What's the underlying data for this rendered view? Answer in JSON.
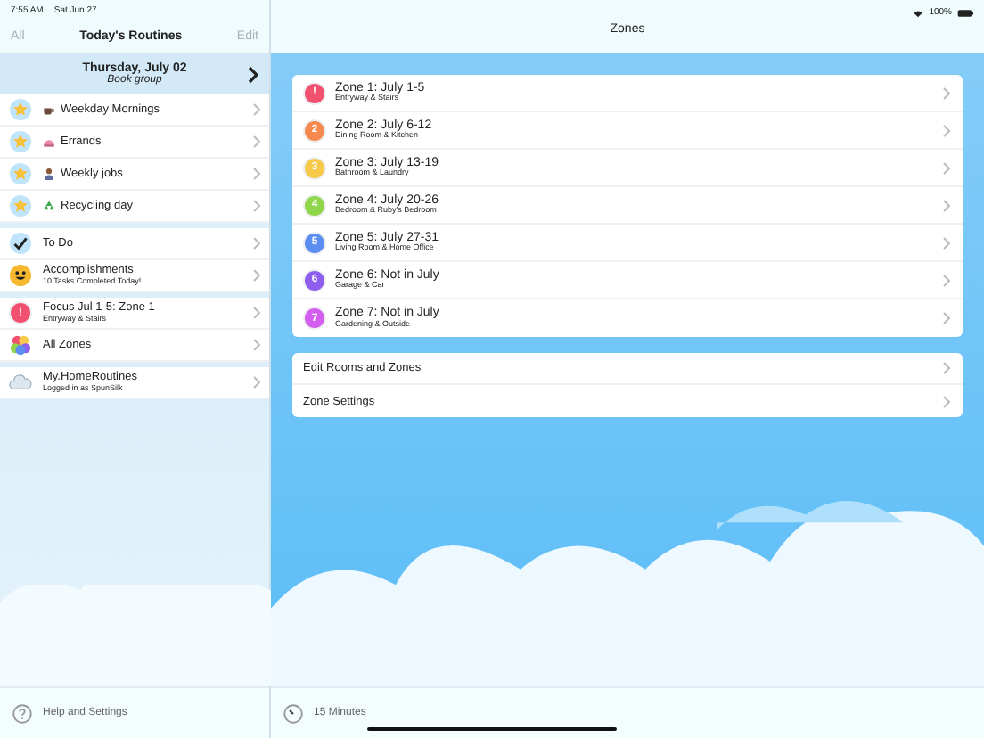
{
  "status_bar": {
    "time": "7:55 AM",
    "date": "Sat Jun 27",
    "battery": "100%"
  },
  "sidebar": {
    "nav_left": "All",
    "title": "Today's Routines",
    "nav_right": "Edit",
    "date_banner": {
      "date": "Thursday, July 02",
      "event": "Book group"
    },
    "groups": [
      [
        {
          "kind": "cup",
          "title": "Weekday Mornings"
        },
        {
          "kind": "cake",
          "title": "Errands"
        },
        {
          "kind": "person",
          "title": "Weekly jobs"
        },
        {
          "kind": "recycle",
          "title": "Recycling day"
        }
      ],
      [
        {
          "kind": "todo",
          "title": "To Do"
        },
        {
          "kind": "smiley",
          "title": "Accomplishments",
          "subtitle": "10 Tasks Completed Today!"
        }
      ],
      [
        {
          "kind": "zone",
          "title": "Focus Jul 1-5: Zone 1",
          "subtitle": "Entryway & Stairs",
          "badge": "!",
          "color": "#f2506f"
        },
        {
          "kind": "zones",
          "title": "All Zones"
        }
      ],
      [
        {
          "kind": "cloud",
          "title": "My.HomeRoutines",
          "subtitle": "Logged in as SpunSilk"
        }
      ]
    ],
    "footer": "Help and Settings"
  },
  "main": {
    "title": "Zones",
    "zones": [
      {
        "badge": "!",
        "color": "#f2506f",
        "title": "Zone 1: July 1-5",
        "subtitle": "Entryway & Stairs"
      },
      {
        "badge": "2",
        "color": "#f68a4e",
        "title": "Zone 2: July 6-12",
        "subtitle": "Dining Room & Kitchen"
      },
      {
        "badge": "3",
        "color": "#f6c94a",
        "title": "Zone 3: July 13-19",
        "subtitle": "Bathroom & Laundry"
      },
      {
        "badge": "4",
        "color": "#8fd64a",
        "title": "Zone 4: July 20-26",
        "subtitle": "Bedroom & Ruby's Bedroom"
      },
      {
        "badge": "5",
        "color": "#5b8ef0",
        "title": "Zone 5: July 27-31",
        "subtitle": "Living Room & Home Office"
      },
      {
        "badge": "6",
        "color": "#8d5ef0",
        "title": "Zone 6: Not in July",
        "subtitle": "Garage & Car"
      },
      {
        "badge": "7",
        "color": "#d45ef0",
        "title": "Zone 7: Not in July",
        "subtitle": "Gardening & Outside"
      }
    ],
    "actions": [
      "Edit Rooms and Zones",
      "Zone Settings"
    ],
    "footer": "15 Minutes"
  }
}
